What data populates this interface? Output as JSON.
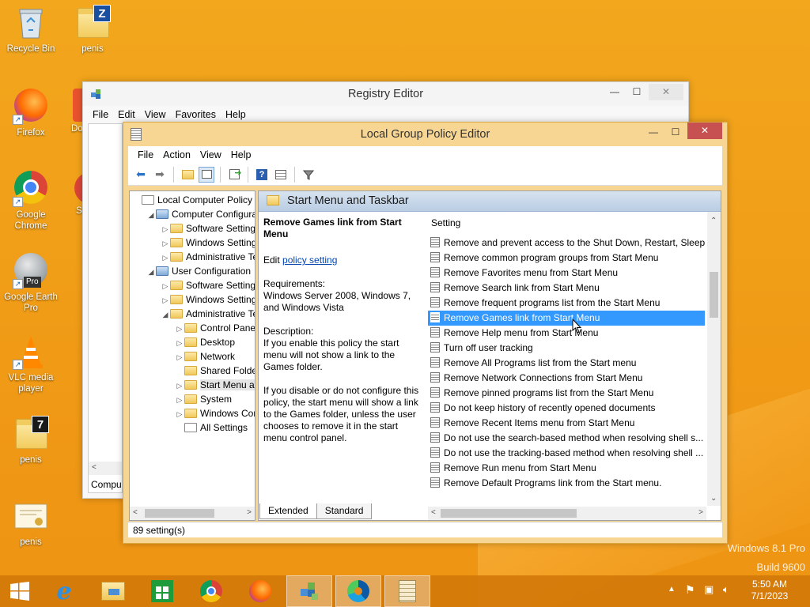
{
  "desktop": {
    "icons": [
      {
        "label": "Recycle Bin"
      },
      {
        "label": "penis"
      },
      {
        "label": "Firefox"
      },
      {
        "label": "Do"
      },
      {
        "label": "Google Chrome"
      },
      {
        "label": "S"
      },
      {
        "label": "Google Earth Pro"
      },
      {
        "label": "VLC media player"
      },
      {
        "label": "penis"
      },
      {
        "label": "penis"
      }
    ],
    "watermark_line1": "Windows 8.1 Pro",
    "watermark_line2": "Build 9600"
  },
  "registry_editor": {
    "title": "Registry Editor",
    "menu": [
      "File",
      "Edit",
      "View",
      "Favorites",
      "Help"
    ],
    "status_partial": "Compu"
  },
  "gpe": {
    "title": "Local Group Policy Editor",
    "menu": [
      "File",
      "Action",
      "View",
      "Help"
    ],
    "tree": [
      {
        "label": "Local Computer Policy",
        "level": 0,
        "exp": "",
        "icon": "doc"
      },
      {
        "label": "Computer Configura",
        "level": 1,
        "exp": "◢",
        "icon": "pc"
      },
      {
        "label": "Software Settings",
        "level": 2,
        "exp": "▷",
        "icon": "folder"
      },
      {
        "label": "Windows Setting",
        "level": 2,
        "exp": "▷",
        "icon": "folder"
      },
      {
        "label": "Administrative Te",
        "level": 2,
        "exp": "▷",
        "icon": "folder"
      },
      {
        "label": "User Configuration",
        "level": 1,
        "exp": "◢",
        "icon": "pc"
      },
      {
        "label": "Software Settings",
        "level": 2,
        "exp": "▷",
        "icon": "folder"
      },
      {
        "label": "Windows Setting",
        "level": 2,
        "exp": "▷",
        "icon": "folder"
      },
      {
        "label": "Administrative Te",
        "level": 2,
        "exp": "◢",
        "icon": "folder"
      },
      {
        "label": "Control Panel",
        "level": 3,
        "exp": "▷",
        "icon": "folder"
      },
      {
        "label": "Desktop",
        "level": 3,
        "exp": "▷",
        "icon": "folder"
      },
      {
        "label": "Network",
        "level": 3,
        "exp": "▷",
        "icon": "folder"
      },
      {
        "label": "Shared Folder",
        "level": 3,
        "exp": "",
        "icon": "folder"
      },
      {
        "label": "Start Menu ar",
        "level": 3,
        "exp": "▷",
        "icon": "folder",
        "selected": true
      },
      {
        "label": "System",
        "level": 3,
        "exp": "▷",
        "icon": "folder"
      },
      {
        "label": "Windows Cor",
        "level": 3,
        "exp": "▷",
        "icon": "folder"
      },
      {
        "label": "All Settings",
        "level": 3,
        "exp": "",
        "icon": "doc"
      }
    ],
    "header": "Start Menu and Taskbar",
    "description": {
      "title": "Remove Games link from Start Menu",
      "edit_prefix": "Edit ",
      "edit_link": "policy setting",
      "requirements_label": "Requirements:",
      "requirements": "Windows Server 2008, Windows 7, and Windows Vista",
      "description_label": "Description:",
      "para1": "If you enable this policy the start menu will not show a link to the Games folder.",
      "para2": "If you disable or do not configure this policy, the start menu will show a link to the Games folder, unless the user chooses to remove it in the start menu control panel."
    },
    "column_header": "Setting",
    "settings": [
      {
        "label": "Remove and prevent access to the Shut Down, Restart, Sleep..."
      },
      {
        "label": "Remove common program groups from Start Menu"
      },
      {
        "label": "Remove Favorites menu from Start Menu"
      },
      {
        "label": "Remove Search link from Start Menu"
      },
      {
        "label": "Remove frequent programs list from the Start Menu"
      },
      {
        "label": "Remove Games link from Start Menu",
        "selected": true
      },
      {
        "label": "Remove Help menu from Start Menu"
      },
      {
        "label": "Turn off user tracking"
      },
      {
        "label": "Remove All Programs list from the Start menu"
      },
      {
        "label": "Remove Network Connections from Start Menu"
      },
      {
        "label": "Remove pinned programs list from the Start Menu"
      },
      {
        "label": "Do not keep history of recently opened documents"
      },
      {
        "label": "Remove Recent Items menu from Start Menu"
      },
      {
        "label": "Do not use the search-based method when resolving shell s..."
      },
      {
        "label": "Do not use the tracking-based method when resolving shell ..."
      },
      {
        "label": "Remove Run menu from Start Menu"
      },
      {
        "label": "Remove Default Programs link from the Start menu."
      }
    ],
    "tabs": [
      "Extended",
      "Standard"
    ],
    "status": "89 setting(s)"
  },
  "taskbar": {
    "time": "5:50 AM",
    "date": "7/1/2023"
  }
}
